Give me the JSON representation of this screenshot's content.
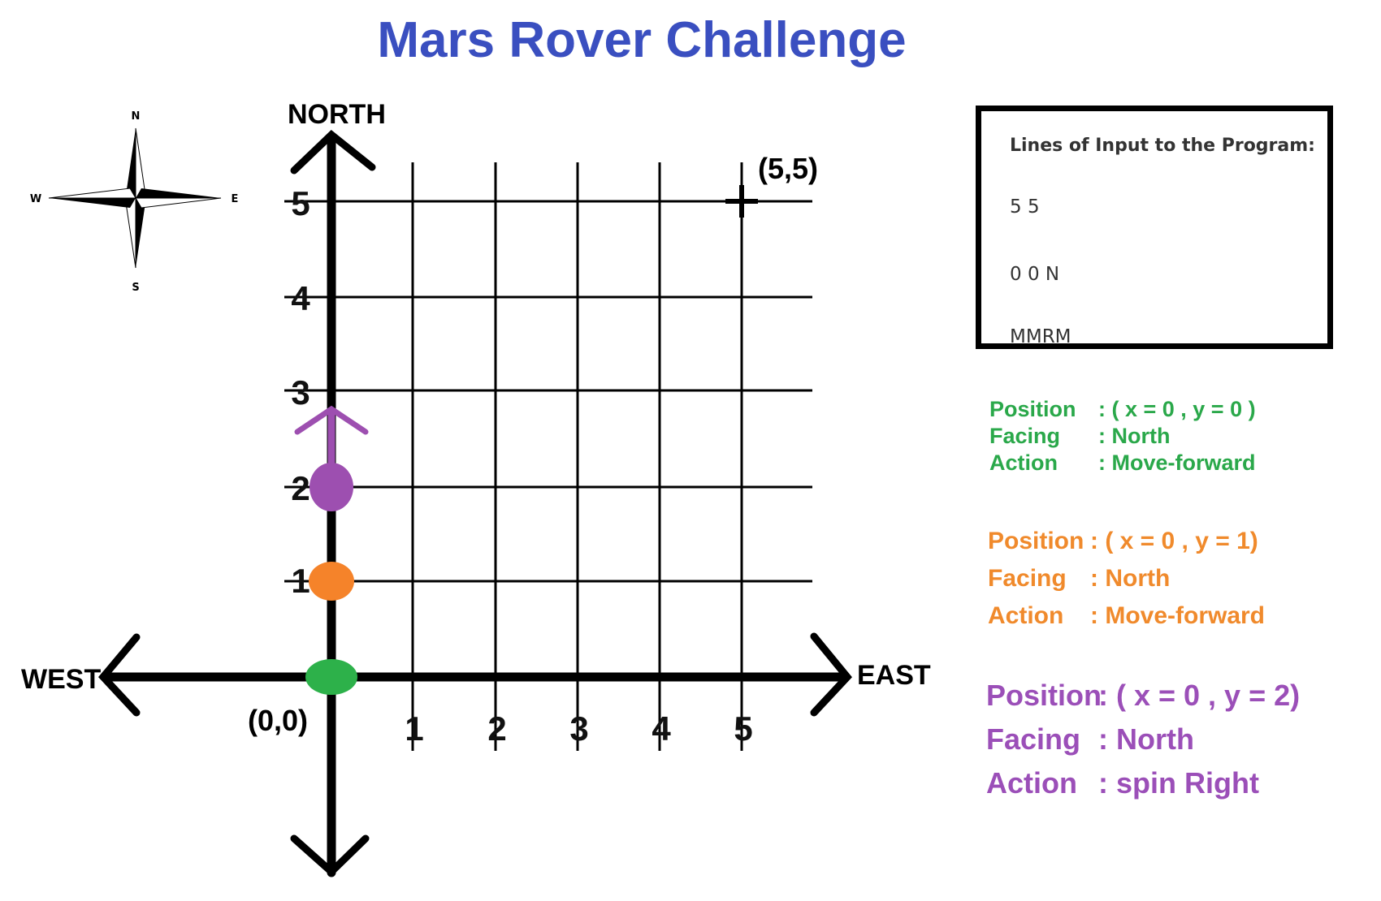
{
  "title": "Mars Rover Challenge",
  "compass": {
    "n": "N",
    "s": "S",
    "e": "E",
    "w": "W"
  },
  "axes": {
    "north": "NORTH",
    "west": "WEST",
    "east": "EAST",
    "origin_label": "(0,0)",
    "corner_label": "(5,5)",
    "x_ticks": [
      "1",
      "2",
      "3",
      "4",
      "5"
    ],
    "y_ticks": [
      "1",
      "2",
      "3",
      "4",
      "5"
    ]
  },
  "rover_positions": [
    {
      "x": 0,
      "y": 0,
      "color": "#2db14a"
    },
    {
      "x": 0,
      "y": 1,
      "color": "#f5832a"
    },
    {
      "x": 0,
      "y": 2,
      "color": "#9d4fb0"
    }
  ],
  "direction_arrow": {
    "from_y": 2,
    "to_y": 3,
    "color": "#9d4fb0"
  },
  "input_box": {
    "heading": "Lines of Input to the Program:",
    "lines": [
      "5 5",
      "0 0  N",
      "MMRM"
    ]
  },
  "states": [
    {
      "color": "#2aa84a",
      "rows": [
        {
          "label": "Position",
          "value": ": ( x = 0 , y = 0 )"
        },
        {
          "label": "Facing",
          "value": ": North"
        },
        {
          "label": "Action",
          "value": ": Move-forward"
        }
      ]
    },
    {
      "color": "#f08a2c",
      "rows": [
        {
          "label": "Position",
          "value": ": ( x = 0 , y = 1)"
        },
        {
          "label": "Facing",
          "value": ": North"
        },
        {
          "label": "Action",
          "value": ": Move-forward"
        }
      ]
    },
    {
      "color": "#9b4fb8",
      "rows": [
        {
          "label": "Position",
          "value": ": ( x = 0 , y = 2)"
        },
        {
          "label": "Facing",
          "value": ": North"
        },
        {
          "label": "Action",
          "value": ": spin Right"
        }
      ]
    }
  ]
}
